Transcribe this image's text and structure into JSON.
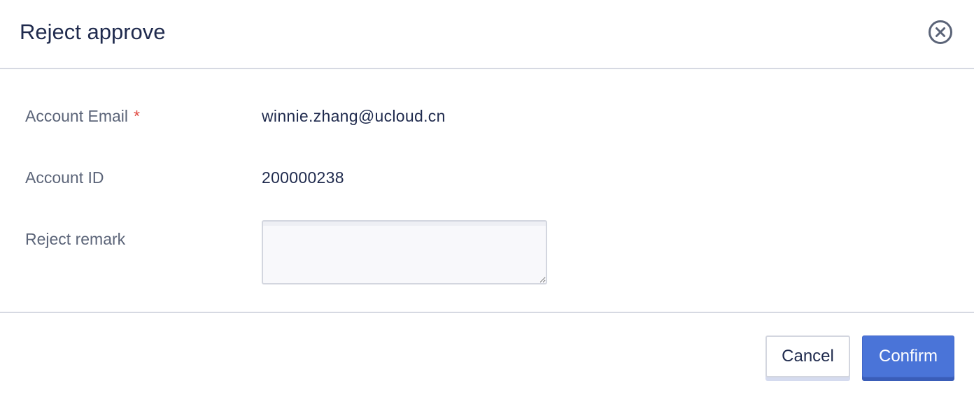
{
  "dialog": {
    "title": "Reject approve",
    "close_icon": "close-circle-icon"
  },
  "form": {
    "account_email": {
      "label": "Account Email",
      "required_mark": "*",
      "value": "winnie.zhang@ucloud.cn"
    },
    "account_id": {
      "label": "Account ID",
      "value": "200000238"
    },
    "reject_remark": {
      "label": "Reject remark",
      "value": ""
    }
  },
  "footer": {
    "cancel_label": "Cancel",
    "confirm_label": "Confirm"
  },
  "colors": {
    "primary": "#4a74d8",
    "text": "#1f2a4d",
    "label": "#5b6478",
    "required": "#e0483f",
    "divider": "#d6d9e2"
  }
}
